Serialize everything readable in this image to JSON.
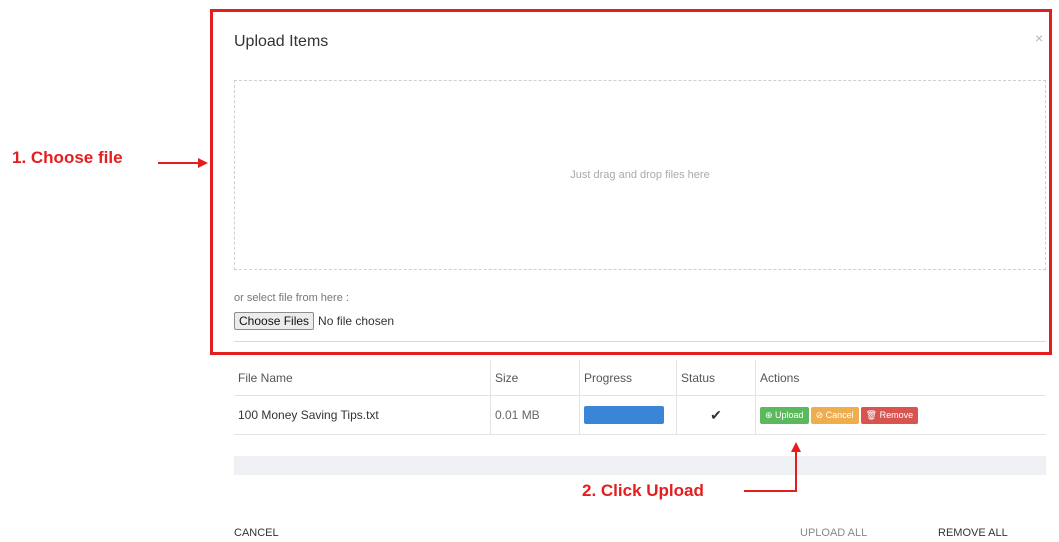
{
  "dialog": {
    "title": "Upload Items",
    "close_symbol": "×",
    "drop_text": "Just drag and drop files here",
    "select_label": "or select file from here :",
    "choose_button": "Choose Files",
    "no_file_text": "No file chosen"
  },
  "table": {
    "headers": [
      "File Name",
      "Size",
      "Progress",
      "Status",
      "Actions"
    ],
    "rows": [
      {
        "file_name": "100 Money Saving Tips.txt",
        "size": "0.01 MB",
        "progress_percent": 100,
        "status_icon": "checkmark-icon",
        "status_glyph": "✔",
        "actions": {
          "upload": "Upload",
          "cancel": "Cancel",
          "remove": "Remove"
        }
      }
    ]
  },
  "footer": {
    "cancel": "CANCEL",
    "upload_all": "UPLOAD ALL",
    "remove_all": "REMOVE ALL"
  },
  "annotations": {
    "step1": "1. Choose file",
    "step2": "2. Click Upload"
  },
  "colors": {
    "highlight": "#e41e1e",
    "progress": "#3a85d6",
    "upload_btn": "#5cb85c",
    "cancel_btn": "#f0ad4e",
    "remove_btn": "#d9534f"
  }
}
